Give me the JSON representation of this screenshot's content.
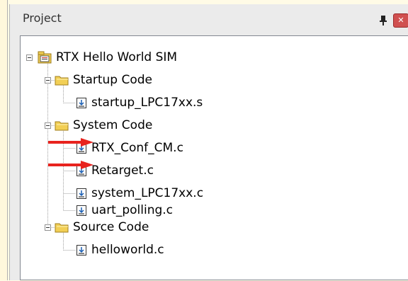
{
  "panel": {
    "title": "Project"
  },
  "tree": {
    "root": {
      "label": "RTX Hello World SIM"
    },
    "groups": [
      {
        "label": "Startup Code",
        "files": [
          "startup_LPC17xx.s"
        ]
      },
      {
        "label": "System Code",
        "files": [
          "RTX_Conf_CM.c",
          "Retarget.c",
          "system_LPC17xx.c",
          "uart_polling.c"
        ]
      },
      {
        "label": "Source Code",
        "files": [
          "helloworld.c"
        ]
      }
    ]
  },
  "colors": {
    "arrow": "#e8231e",
    "folder": "#f2cf55",
    "background": "#fffbe6",
    "panel": "#ebebeb"
  },
  "icons": [
    "pin-icon",
    "close-icon",
    "project-root-icon",
    "folder-icon",
    "file-icon",
    "collapse-icon",
    "red-arrow-icon"
  ]
}
